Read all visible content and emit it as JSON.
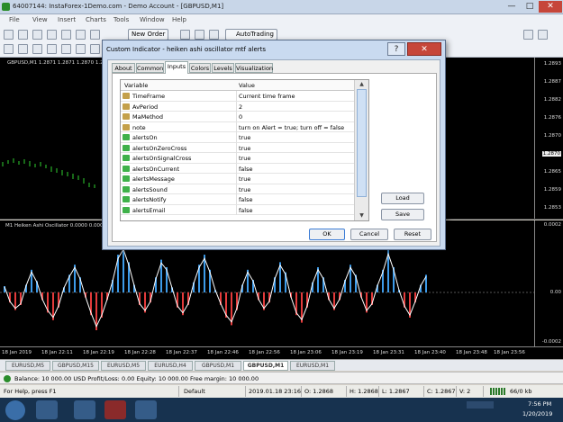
{
  "window": {
    "title": "64007144: InstaForex-1Demo.com - Demo Account - [GBPUSD,M1]",
    "controls": [
      "—",
      "□",
      "✕"
    ]
  },
  "menu": [
    "File",
    "View",
    "Insert",
    "Charts",
    "Tools",
    "Window",
    "Help"
  ],
  "toolbar": {
    "new_order": "New Order",
    "autotrading": "AutoTrading"
  },
  "main_chart": {
    "header": "GBPUSD,M1  1.2871  1.2871  1.2870  1.2...",
    "prices": [
      "1.2893",
      "1.2887",
      "1.2882",
      "1.2876",
      "1.2870",
      "1.2865",
      "1.2859",
      "1.2853",
      "1.2847"
    ],
    "current_price": "1.2870"
  },
  "osc_chart": {
    "header": "M1  Heiken Ashi Oscillator 0.0000 0.0000",
    "levels": [
      "0.0002",
      "0.00",
      "-0.0002"
    ]
  },
  "x_axis": [
    "18 Jan 2019",
    "18 Jan 22:11",
    "18 Jan 22:19",
    "18 Jan 22:28",
    "18 Jan 22:37",
    "18 Jan 22:46",
    "18 Jan 22:56",
    "18 Jan 23:06",
    "18 Jan 23:19",
    "18 Jan 23:31",
    "18 Jan 23:40",
    "18 Jan 23:48",
    "18 Jan 23:56"
  ],
  "chart_tabs": [
    "EURUSD,M5",
    "GBPUSD,M15",
    "EURUSD,M5",
    "EURUSD,H4",
    "GBPUSD,M1",
    "GBPUSD,M1",
    "EURUSD,M1"
  ],
  "balance_bar": {
    "text": "Balance: 10 000.00 USD  Profit/Loss: 0.00  Equity: 10 000.00  Free margin: 10 000.00"
  },
  "status": {
    "help": "For Help, press F1",
    "profile": "Default",
    "datetime": "2019.01.18 23:16",
    "open": "O: 1.2868",
    "high": "H: 1.2868",
    "low": "L: 1.2867",
    "close": "C: 1.2867",
    "volume": "V: 2",
    "traffic": "66/0 kb"
  },
  "taskbar": {
    "time": "7:56 PM",
    "date": "1/20/2019"
  },
  "dialog": {
    "title": "Custom Indicator - heiken ashi oscillator mtf alerts",
    "help": "?",
    "close": "✕",
    "tabs": [
      "About",
      "Common",
      "Inputs",
      "Colors",
      "Levels",
      "Visualization"
    ],
    "active_tab": "Inputs",
    "columns": [
      "Variable",
      "Value"
    ],
    "rows": [
      {
        "name": "TimeFrame",
        "value": "Current time frame",
        "icon": "ab"
      },
      {
        "name": "AvPeriod",
        "value": "2",
        "icon": "ab"
      },
      {
        "name": "MaMethod",
        "value": "0",
        "icon": "ab"
      },
      {
        "name": "note",
        "value": "turn on Alert = true; turn off = false",
        "icon": "ab"
      },
      {
        "name": "alertsOn",
        "value": "true",
        "icon": "gr"
      },
      {
        "name": "alertsOnZeroCross",
        "value": "true",
        "icon": "gr"
      },
      {
        "name": "alertsOnSignalCross",
        "value": "true",
        "icon": "gr"
      },
      {
        "name": "alertsOnCurrent",
        "value": "false",
        "icon": "gr"
      },
      {
        "name": "alertsMessage",
        "value": "true",
        "icon": "gr"
      },
      {
        "name": "alertsSound",
        "value": "true",
        "icon": "gr"
      },
      {
        "name": "alertsNotify",
        "value": "false",
        "icon": "gr"
      },
      {
        "name": "alertsEmail",
        "value": "false",
        "icon": "gr"
      }
    ],
    "load": "Load",
    "save": "Save",
    "ok": "OK",
    "cancel": "Cancel",
    "reset": "Reset"
  }
}
